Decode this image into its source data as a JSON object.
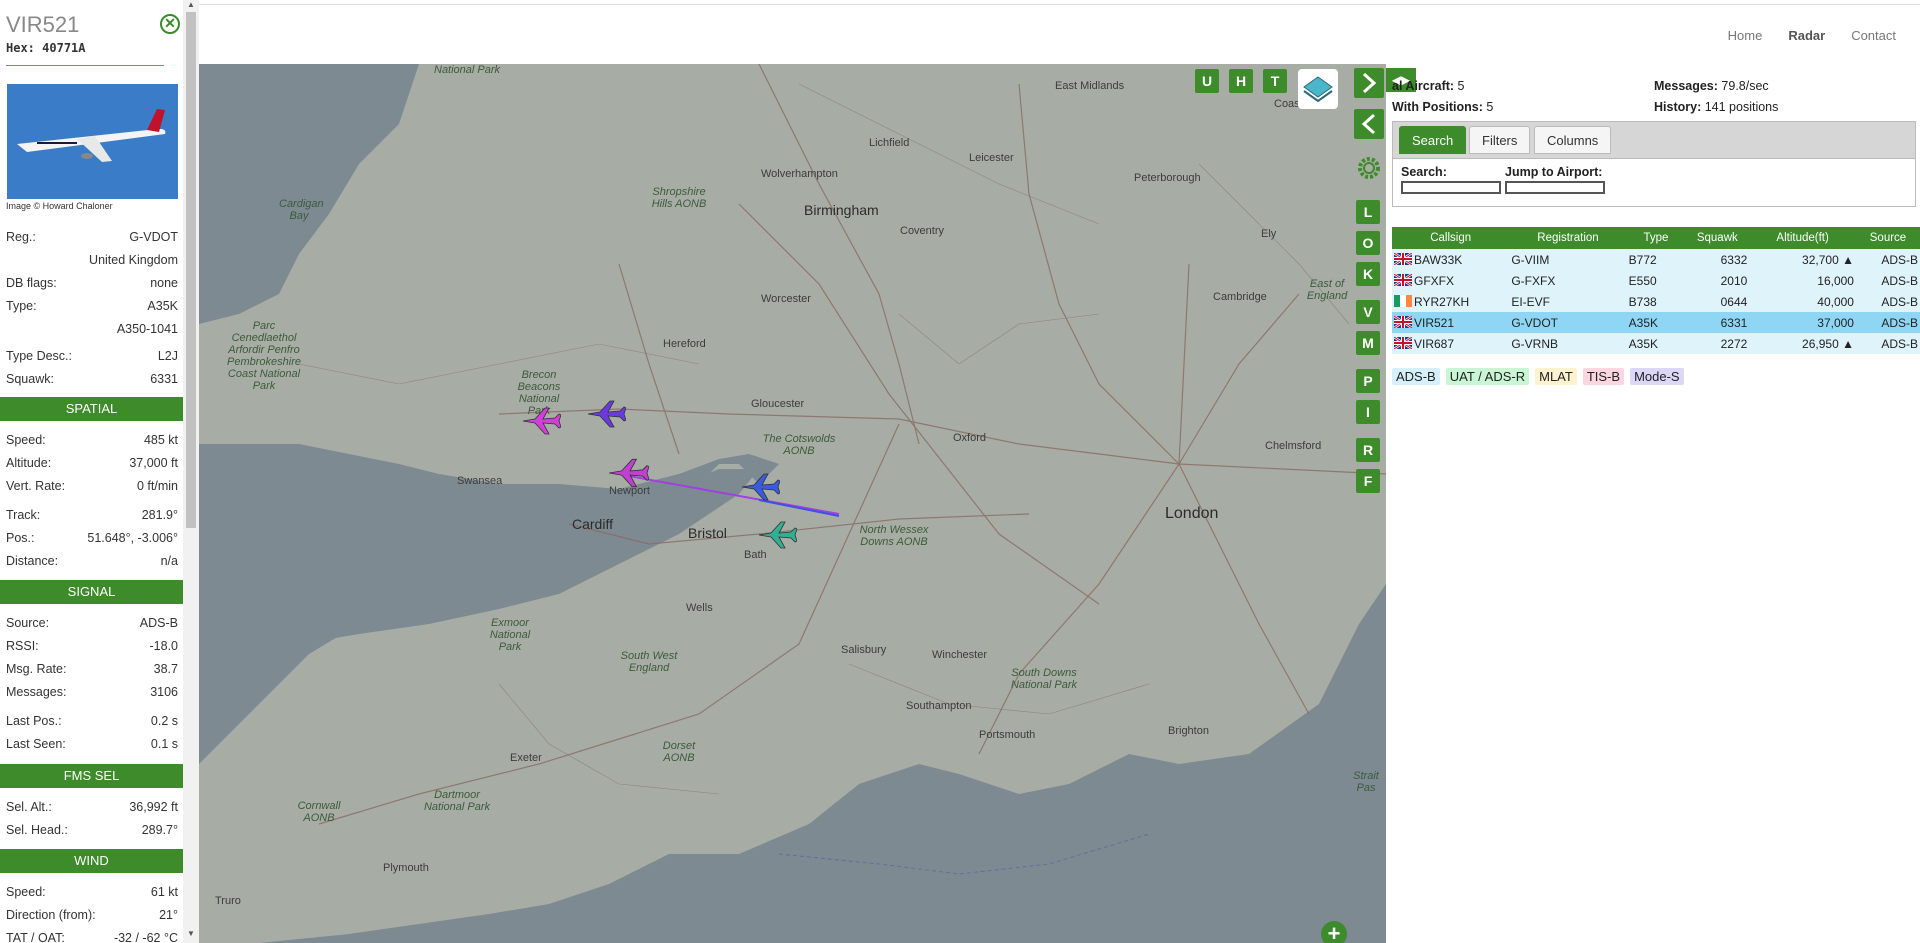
{
  "nav": {
    "items": [
      "Home",
      "Radar",
      "Contact"
    ],
    "active": "Radar"
  },
  "aircraft": {
    "callsign": "VIR521",
    "hex_label": "Hex:",
    "hex": "40771A",
    "photo_credit": "Image © Howard Chaloner",
    "fields": [
      {
        "k": "Reg.:",
        "v": "G-VDOT"
      },
      {
        "k": "",
        "v": "United Kingdom"
      },
      {
        "k": "DB flags:",
        "v": "none"
      },
      {
        "k": "Type:",
        "v": "A35K"
      },
      {
        "k": "",
        "v": "A350-1041"
      },
      {
        "k": "Type Desc.:",
        "v": "L2J"
      },
      {
        "k": "Squawk:",
        "v": "6331"
      }
    ],
    "sections": {
      "spatial": "SPATIAL",
      "signal": "SIGNAL",
      "fms": "FMS SEL",
      "wind": "WIND"
    },
    "spatial": [
      {
        "k": "Speed:",
        "v": "485 kt"
      },
      {
        "k": "Altitude:",
        "v": "37,000 ft"
      },
      {
        "k": "Vert. Rate:",
        "v": "0 ft/min"
      },
      {
        "k": "Track:",
        "v": "281.9°"
      },
      {
        "k": "Pos.:",
        "v": "51.648°, -3.006°"
      },
      {
        "k": "Distance:",
        "v": "n/a"
      }
    ],
    "signal": [
      {
        "k": "Source:",
        "v": "ADS-B"
      },
      {
        "k": "RSSI:",
        "v": "-18.0"
      },
      {
        "k": "Msg. Rate:",
        "v": "38.7"
      },
      {
        "k": "Messages:",
        "v": "3106"
      },
      {
        "k": "Last Pos.:",
        "v": "0.2 s"
      },
      {
        "k": "Last Seen:",
        "v": "0.1 s"
      }
    ],
    "fms": [
      {
        "k": "Sel. Alt.:",
        "v": "36,992 ft"
      },
      {
        "k": "Sel. Head.:",
        "v": "289.7°"
      }
    ],
    "wind": [
      {
        "k": "Speed:",
        "v": "61 kt"
      },
      {
        "k": "Direction (from):",
        "v": "21°"
      },
      {
        "k": "TAT / OAT:",
        "v": "-32 / -62 °C"
      }
    ]
  },
  "map": {
    "buttons": [
      "U",
      "H",
      "T"
    ],
    "side_letters": [
      "L",
      "O",
      "K",
      "V",
      "M",
      "P",
      "I",
      "R",
      "F"
    ],
    "labels": {
      "birmingham": "Birmingham",
      "bristol": "Bristol",
      "cardiff": "Cardiff",
      "london": "London",
      "lichfield": "Lichfield",
      "leicester": "Leicester",
      "wolverhampton": "Wolverhampton",
      "coventry": "Coventry",
      "peterborough": "Peterborough",
      "worcester": "Worcester",
      "hereford": "Hereford",
      "gloucester": "Gloucester",
      "oxford": "Oxford",
      "cambridge": "Cambridge",
      "chelmsford": "Chelmsford",
      "swansea": "Swansea",
      "newport": "Newport",
      "bath": "Bath",
      "wells": "Wells",
      "salisbury": "Salisbury",
      "winchester": "Winchester",
      "southampton": "Southampton",
      "portsmouth": "Portsmouth",
      "brighton": "Brighton",
      "exeter": "Exeter",
      "plymouth": "Plymouth",
      "truro": "Truro",
      "ely": "Ely",
      "cotswolds": "The Cotswolds AONB",
      "nwessex": "North Wessex Downs AONB",
      "brecon": "Brecon Beacons National Park",
      "exmoor": "Exmoor National Park",
      "dartmoor": "Dartmoor National Park",
      "sdowns": "South Downs National Park",
      "shropshire": "Shropshire Hills AONB",
      "pembs": "Parc Cenedlaethol Arfordir Penfro Pembrokeshire Coast National Park",
      "cardigan": "Cardigan Bay",
      "dorset": "Dorset AONB",
      "cornwall": "Cornwall AONB",
      "eastengland": "East of England",
      "swengland": "South West England",
      "natpark": "National Park",
      "eastmid": "East Midlands",
      "strait": "Strait Pas",
      "coast": "Coast"
    },
    "aircraft_colors": [
      "#d040d8",
      "#6a3ae0",
      "#c040d0",
      "#3a5ae0",
      "#30b090"
    ]
  },
  "right_panel": {
    "total_label": "al Aircraft:",
    "total": "5",
    "positions_label": "With Positions:",
    "positions": "5",
    "messages_label": "Messages:",
    "messages": "79.8/sec",
    "history_label": "History:",
    "history": "141 positions",
    "tabs": [
      "Search",
      "Filters",
      "Columns"
    ],
    "search_label": "Search:",
    "airport_label": "Jump to Airport:",
    "columns": [
      "Callsign",
      "Registration",
      "Type",
      "Squawk",
      "Altitude(ft)",
      "Source"
    ],
    "rows": [
      {
        "flag": "uk",
        "callsign": "BAW33K",
        "reg": "G-VIIM",
        "type": "B772",
        "squawk": "6332",
        "alt": "32,700 ▲",
        "src": "ADS-B"
      },
      {
        "flag": "uk",
        "callsign": "GFXFX",
        "reg": "G-FXFX",
        "type": "E550",
        "squawk": "2010",
        "alt": "16,000",
        "src": "ADS-B"
      },
      {
        "flag": "ie",
        "callsign": "RYR27KH",
        "reg": "EI-EVF",
        "type": "B738",
        "squawk": "0644",
        "alt": "40,000",
        "src": "ADS-B"
      },
      {
        "flag": "uk",
        "callsign": "VIR521",
        "reg": "G-VDOT",
        "type": "A35K",
        "squawk": "6331",
        "alt": "37,000",
        "src": "ADS-B"
      },
      {
        "flag": "uk",
        "callsign": "VIR687",
        "reg": "G-VRNB",
        "type": "A35K",
        "squawk": "2272",
        "alt": "26,950 ▲",
        "src": "ADS-B"
      }
    ],
    "selected_row": 3,
    "legend": [
      {
        "label": "ADS-B",
        "color": "#d6f0fb"
      },
      {
        "label": "UAT / ADS-R",
        "color": "#c9f5d5"
      },
      {
        "label": "MLAT",
        "color": "#fdf2cf"
      },
      {
        "label": "TIS-B",
        "color": "#fbd5e0"
      },
      {
        "label": "Mode-S",
        "color": "#dcd6f7"
      }
    ]
  }
}
